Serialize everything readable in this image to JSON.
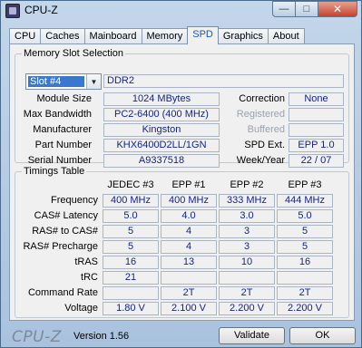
{
  "window": {
    "title": "CPU-Z"
  },
  "tabs": [
    {
      "label": "CPU"
    },
    {
      "label": "Caches"
    },
    {
      "label": "Mainboard"
    },
    {
      "label": "Memory"
    },
    {
      "label": "SPD"
    },
    {
      "label": "Graphics"
    },
    {
      "label": "About"
    }
  ],
  "active_tab": "SPD",
  "memory_slot": {
    "legend": "Memory Slot Selection",
    "slot_selected": "Slot #4",
    "type": "DDR2",
    "labels": {
      "module_size": "Module Size",
      "max_bandwidth": "Max Bandwidth",
      "manufacturer": "Manufacturer",
      "part_number": "Part Number",
      "serial_number": "Serial Number",
      "correction": "Correction",
      "registered": "Registered",
      "buffered": "Buffered",
      "spd_ext": "SPD Ext.",
      "week_year": "Week/Year"
    },
    "values": {
      "module_size": "1024 MBytes",
      "max_bandwidth": "PC2-6400 (400 MHz)",
      "manufacturer": "Kingston",
      "part_number": "KHX6400D2LL/1GN",
      "serial_number": "A9337518",
      "correction": "None",
      "registered": "",
      "buffered": "",
      "spd_ext": "EPP 1.0",
      "week_year": "22 / 07"
    }
  },
  "timings": {
    "legend": "Timings Table",
    "columns": [
      "JEDEC #3",
      "EPP #1",
      "EPP #2",
      "EPP #3"
    ],
    "rows": [
      {
        "label": "Frequency",
        "values": [
          "400 MHz",
          "400 MHz",
          "333 MHz",
          "444 MHz"
        ]
      },
      {
        "label": "CAS# Latency",
        "values": [
          "5.0",
          "4.0",
          "3.0",
          "5.0"
        ]
      },
      {
        "label": "RAS# to CAS#",
        "values": [
          "5",
          "4",
          "3",
          "5"
        ]
      },
      {
        "label": "RAS# Precharge",
        "values": [
          "5",
          "4",
          "3",
          "5"
        ]
      },
      {
        "label": "tRAS",
        "values": [
          "16",
          "13",
          "10",
          "16"
        ]
      },
      {
        "label": "tRC",
        "values": [
          "21",
          "",
          "",
          ""
        ]
      },
      {
        "label": "Command Rate",
        "values": [
          "",
          "2T",
          "2T",
          "2T"
        ]
      },
      {
        "label": "Voltage",
        "values": [
          "1.80 V",
          "2.100 V",
          "2.200 V",
          "2.200 V"
        ]
      }
    ]
  },
  "footer": {
    "brand": "CPU-Z",
    "version": "Version 1.56",
    "validate_label": "Validate",
    "ok_label": "OK"
  },
  "icons": {
    "minimize": "minimize-icon",
    "maximize": "maximize-icon",
    "close": "close-icon",
    "dropdown": "chevron-down-icon"
  }
}
